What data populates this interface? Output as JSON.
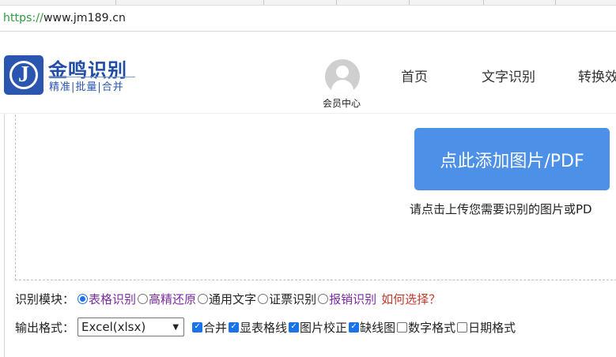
{
  "browser": {
    "url_scheme": "https://",
    "url_rest": "www.jm189.cn"
  },
  "header": {
    "logo_letter": "J",
    "logo_title": "金鸣识别",
    "logo_subtitle": "精准|批量|合并",
    "member_label": "会员中心",
    "nav": [
      "首页",
      "文字识别",
      "转换效"
    ]
  },
  "upload": {
    "button_label": "点此添加图片/PDF",
    "hint": "请点击上传您需要识别的图片或PD"
  },
  "module": {
    "label": "识别模块：",
    "options": [
      {
        "label": "表格识别",
        "selected": true
      },
      {
        "label": "高精还原",
        "selected": false
      },
      {
        "label": "通用文字",
        "selected": false
      },
      {
        "label": "证票识别",
        "selected": false
      },
      {
        "label": "报销识别",
        "selected": false
      }
    ],
    "help_link": "如何选择？"
  },
  "output": {
    "label": "输出格式：",
    "format_selected": "Excel(xlsx)",
    "checkboxes": [
      {
        "label": "合并",
        "checked": true
      },
      {
        "label": "显表格线",
        "checked": true
      },
      {
        "label": "图片校正",
        "checked": true
      },
      {
        "label": "缺线图",
        "checked": true
      },
      {
        "label": "数字格式",
        "checked": false
      },
      {
        "label": "日期格式",
        "checked": false
      }
    ]
  },
  "colors": {
    "brand_blue": "#2a56b0",
    "button_blue": "#4d90e8",
    "purple_link": "#7b2ba0",
    "red_link": "#c0392b"
  }
}
